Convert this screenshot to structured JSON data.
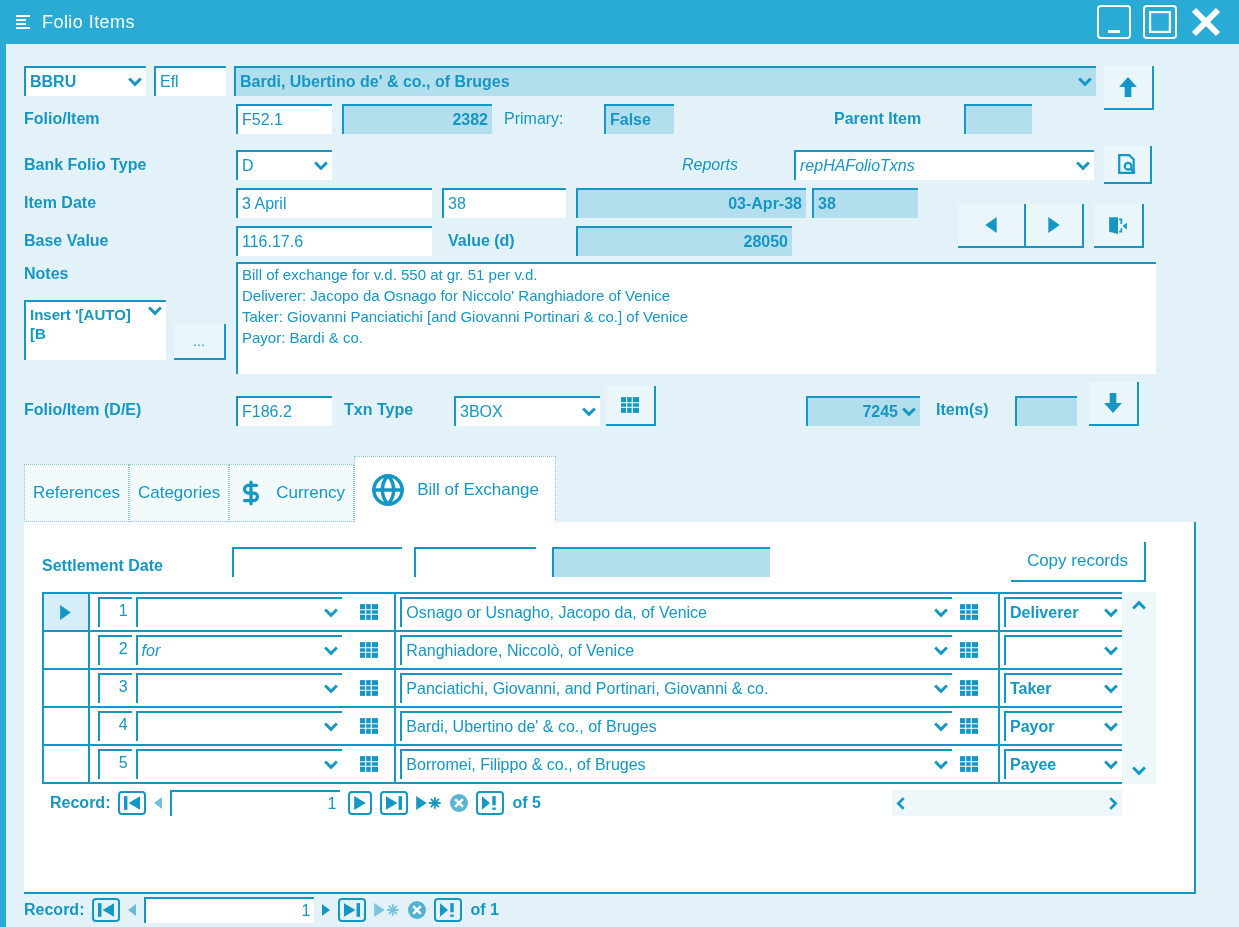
{
  "window": {
    "title": "Folio Items"
  },
  "header": {
    "bank_code": "BBRU",
    "code": "Efl",
    "bank_name": "Bardi, Ubertino de' & co., of Bruges"
  },
  "form": {
    "folio_item_label": "Folio/Item",
    "folio_item": "F52.1",
    "item_id": "2382",
    "primary_label": "Primary:",
    "primary": "False",
    "parent_label": "Parent Item",
    "bank_folio_type_label": "Bank Folio Type",
    "bank_folio_type": "D",
    "reports_label": "Reports",
    "report": "repHAFolioTxns",
    "item_date_label": "Item Date",
    "item_date": "3 April",
    "item_year": "38",
    "full_date": "03-Apr-38",
    "year_2": "38",
    "base_value_label": "Base Value",
    "base_value": "116.17.6",
    "value_label": "Value (d)",
    "value": "28050",
    "notes_label": "Notes",
    "notes": [
      "Bill of exchange for v.d. 550 at gr. 51 per v.d.",
      "Deliverer: Jacopo da Osnago for Niccolo' Ranghiadore of Venice",
      "Taker: Giovanni Panciatichi [and Giovanni Portinari & co.] of Venice",
      "Payor: Bardi & co."
    ],
    "insert_combo": "Insert '[AUTO][B",
    "ellipsis_button": "...",
    "folio_de_label": "Folio/Item (D/E)",
    "folio_de": "F186.2",
    "txn_type_label": "Txn Type",
    "txn_type": "3BOX",
    "item_count": "7245",
    "items_label": "Item(s)"
  },
  "tabs": [
    {
      "label": "References",
      "selected": false,
      "kind": "plain"
    },
    {
      "label": "Categories",
      "selected": false,
      "kind": "plain"
    },
    {
      "label": "Currency",
      "selected": false,
      "kind": "currency"
    },
    {
      "label": "Bill of Exchange",
      "selected": true,
      "kind": "globe"
    }
  ],
  "subform": {
    "settlement_label": "Settlement Date",
    "copy_button": "Copy records",
    "rows": [
      {
        "selected": true,
        "number": "1",
        "name": "Osnago or Usnagho, Jacopo da, of Venice",
        "role": "Deliverer"
      },
      {
        "selected": false,
        "number": "2",
        "prefix": "for",
        "name": "Ranghiadore, Niccolò, of Venice"
      },
      {
        "selected": false,
        "number": "3",
        "name": "Panciatichi, Giovanni, and Portinari, Giovanni & co.",
        "role": "Taker"
      },
      {
        "selected": false,
        "number": "4",
        "name": "Bardi, Ubertino de' & co., of Bruges",
        "role": "Payor"
      },
      {
        "selected": false,
        "number": "5",
        "name": "Borromei, Filippo & co., of Bruges",
        "role": "Payee"
      }
    ],
    "navigator": {
      "label": "Record:",
      "current": "1",
      "total": "of 5"
    }
  },
  "navigator": {
    "label": "Record:",
    "current": "1",
    "total": "of 1"
  }
}
